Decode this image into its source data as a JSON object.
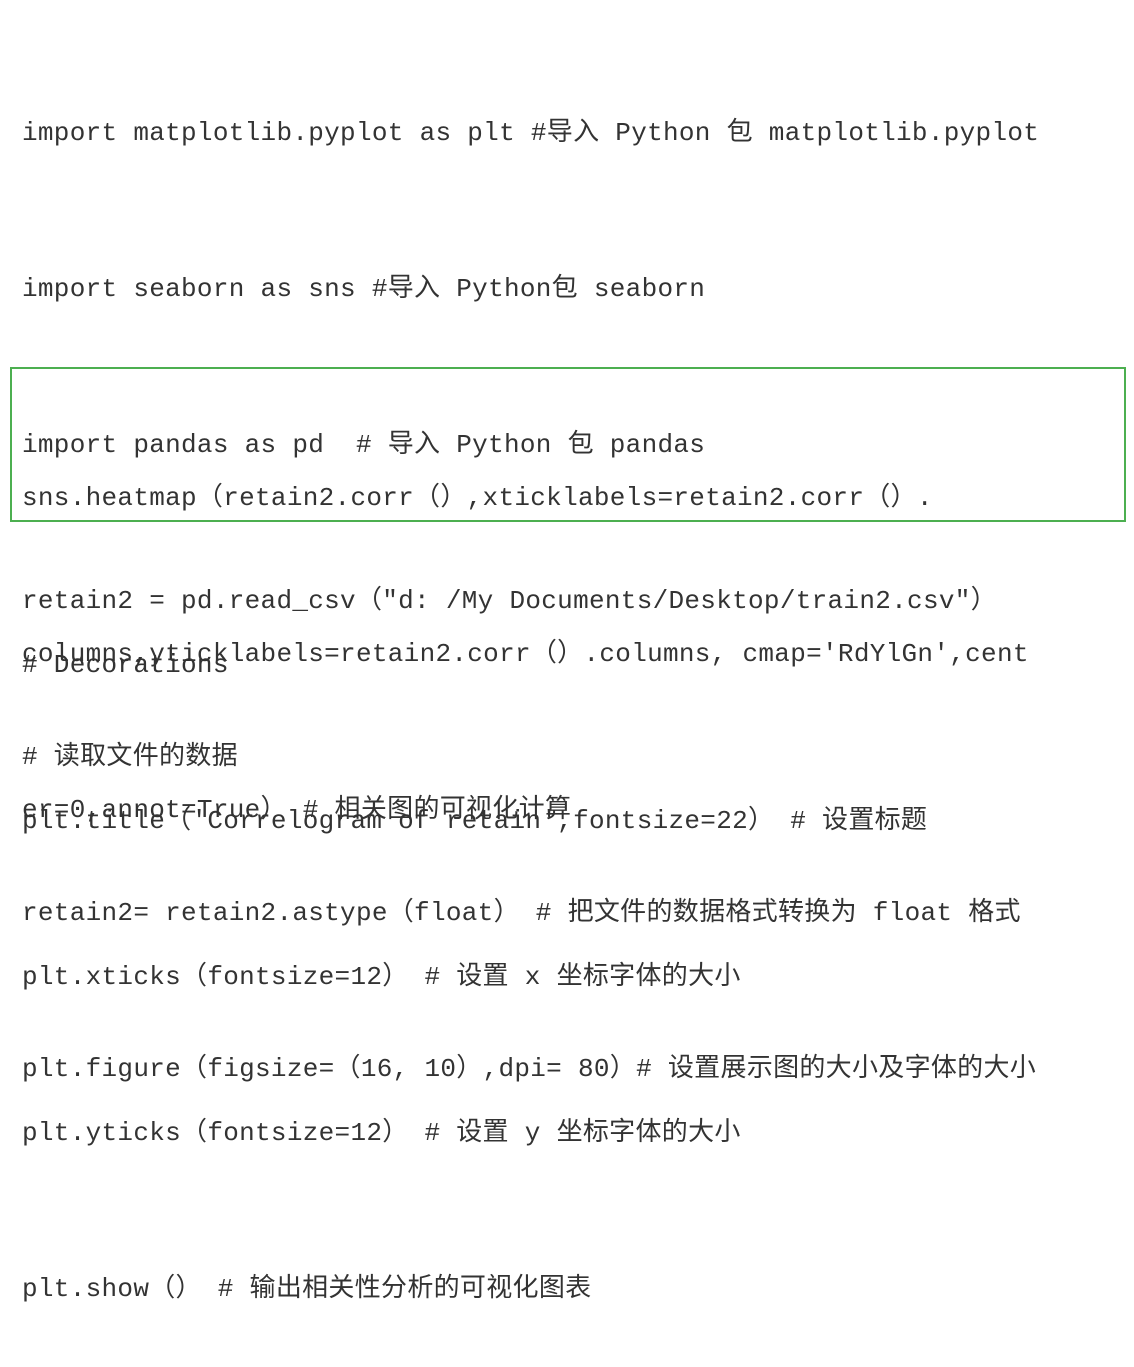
{
  "code": {
    "before": [
      "import matplotlib.pyplot as plt #导入 Python 包 matplotlib.pyplot",
      "import seaborn as sns #导入 Python包 seaborn",
      "import pandas as pd  # 导入 Python 包 pandas",
      "retain2 = pd.read_csv（\"d: /My Documents/Desktop/train2.csv\"）",
      "# 读取文件的数据",
      "retain2= retain2.astype（float） # 把文件的数据格式转换为 float 格式",
      "plt.figure（figsize=（16, 10）,dpi= 80）# 设置展示图的大小及字体的大小"
    ],
    "highlighted": [
      "sns.heatmap（retain2.corr（）,xticklabels=retain2.corr（）.",
      "columns,yticklabels=retain2.corr（）.columns, cmap='RdYlGn',cent",
      "er=0,annot=True） # 相关图的可视化计算"
    ],
    "after": [
      "# Decorations",
      "plt.title（'Correlogram of retain',fontsize=22） # 设置标题",
      "plt.xticks（fontsize=12） # 设置 x 坐标字体的大小",
      "plt.yticks（fontsize=12） # 设置 y 坐标字体的大小",
      "plt.show（） # 输出相关性分析的可视化图表"
    ]
  },
  "colors": {
    "text": "#333333",
    "highlight_border": "#4caf50",
    "background": "#ffffff"
  }
}
